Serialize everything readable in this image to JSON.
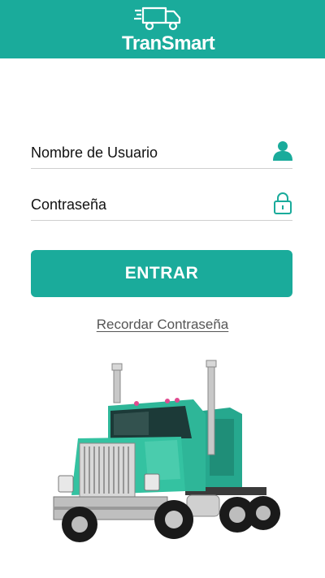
{
  "header": {
    "brand_name": "TranSmart",
    "logo_icon": "truck-icon",
    "background_color": "#1aab9b"
  },
  "login_form": {
    "username": {
      "placeholder": "Nombre de Usuario",
      "icon": "user-icon"
    },
    "password": {
      "placeholder": "Contraseña",
      "icon": "lock-icon"
    },
    "submit_label": "ENTRAR",
    "remember_link": "Recordar Contraseña",
    "accent_color": "#1aab9b"
  },
  "illustration": {
    "subject": "truck-image"
  }
}
